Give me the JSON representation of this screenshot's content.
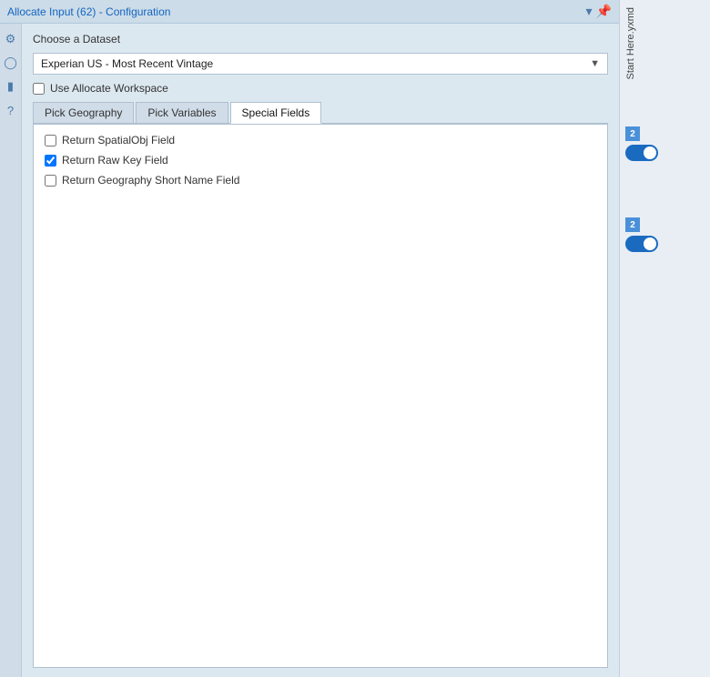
{
  "titleBar": {
    "text": "Allocate Input (62) - Configuration",
    "pin_icon": "📌",
    "dropdown_icon": "▾"
  },
  "sidebar": {
    "icons": [
      "⚙",
      "◌",
      "⬟",
      "?"
    ]
  },
  "main": {
    "dataset_label": "Choose a Dataset",
    "dataset_value": "Experian US - Most Recent Vintage",
    "workspace_checkbox_label": "Use Allocate Workspace",
    "workspace_checked": false
  },
  "tabs": {
    "items": [
      {
        "id": "pick-geography",
        "label": "Pick Geography",
        "active": false
      },
      {
        "id": "pick-variables",
        "label": "Pick Variables",
        "active": false
      },
      {
        "id": "special-fields",
        "label": "Special Fields",
        "active": true
      }
    ]
  },
  "specialFields": {
    "fields": [
      {
        "id": "spatial-obj",
        "label": "Return SpatialObj Field",
        "checked": false
      },
      {
        "id": "raw-key",
        "label": "Return Raw Key Field",
        "checked": true
      },
      {
        "id": "geo-short-name",
        "label": "Return Geography Short Name Field",
        "checked": false
      }
    ]
  },
  "rightPanel": {
    "filename": "Start Here.yxmd",
    "toggle1_label": "2",
    "toggle2_label": "2"
  }
}
